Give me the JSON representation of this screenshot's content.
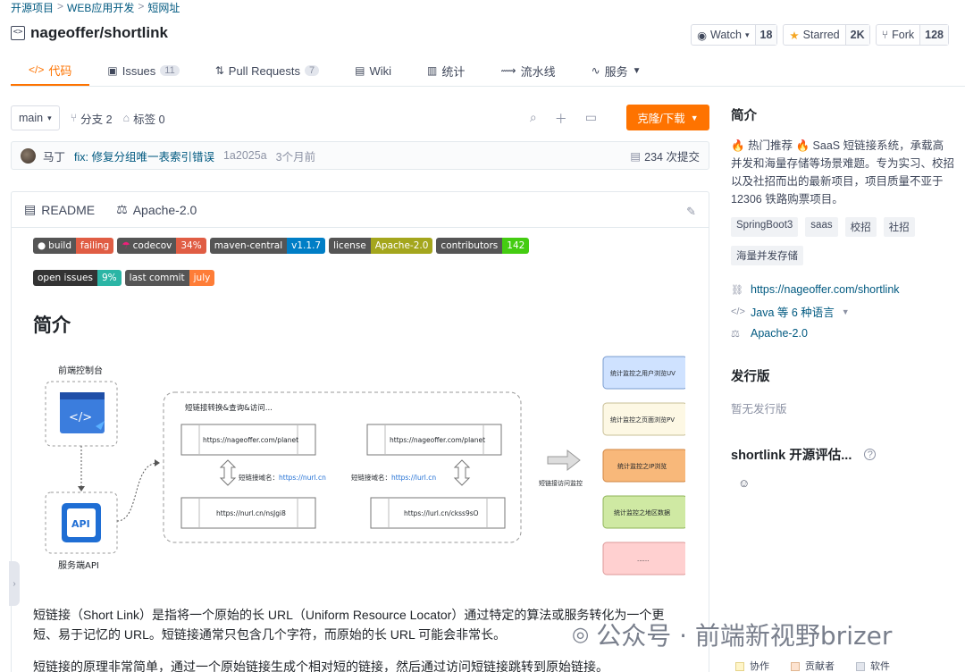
{
  "breadcrumb": [
    "开源项目",
    "WEB应用开发",
    "短网址"
  ],
  "repo": {
    "name": "nageoffer/shortlink"
  },
  "actions": {
    "watch": {
      "label": "Watch",
      "count": "18"
    },
    "star": {
      "label": "Starred",
      "count": "2K"
    },
    "fork": {
      "label": "Fork",
      "count": "128"
    }
  },
  "tabs": [
    {
      "icon": "</>",
      "label": "代码"
    },
    {
      "icon": "▣",
      "label": "Issues",
      "count": "11"
    },
    {
      "icon": "⇅",
      "label": "Pull Requests",
      "count": "7"
    },
    {
      "icon": "▤",
      "label": "Wiki"
    },
    {
      "icon": "▥",
      "label": "统计"
    },
    {
      "icon": "⟿",
      "label": "流水线"
    },
    {
      "icon": "∿",
      "label": "服务"
    }
  ],
  "toolbar": {
    "branch": "main",
    "branches": "分支 2",
    "tags": "标签 0",
    "clone": "克隆/下载"
  },
  "commit": {
    "author": "马丁",
    "message": "fix: 修复分组唯一表索引错误",
    "sha": "1a2025a",
    "time": "3个月前",
    "count": "234 次提交"
  },
  "readme": {
    "tab1": "README",
    "tab2": "Apache-2.0",
    "badges": [
      {
        "k": "build",
        "v": "failing",
        "color": "#e05d44"
      },
      {
        "k": "codecov",
        "v": "34%",
        "color": "#e05d44"
      },
      {
        "k": "maven-central",
        "v": "v1.1.7",
        "color": "#007ec6"
      },
      {
        "k": "license",
        "v": "Apache-2.0",
        "color": "#a4a61d"
      },
      {
        "k": "contributors",
        "v": "142",
        "color": "#4c1"
      },
      {
        "k": "open issues",
        "v": "9%",
        "color": "#2bb5a5"
      },
      {
        "k": "last commit",
        "v": "july",
        "color": "#fe7d37"
      }
    ],
    "h1": "简介",
    "para1": "短链接（Short Link）是指将一个原始的长 URL（Uniform Resource Locator）通过特定的算法或服务转化为一个更短、易于记忆的 URL。短链接通常只包含几个字符，而原始的长 URL 可能会非常长。",
    "para2": "短链接的原理非常简单，通过一个原始链接生成个相对短的链接，然后通过访问短链接跳转到原始链接。"
  },
  "diagram": {
    "frontend": "前端控制台",
    "backend": "服务端API",
    "api_chip": "API",
    "group_title": "短链接转换&查询&访问...",
    "url1": "https://nageoffer.com/planet",
    "url2": "https://nageoffer.com/planet",
    "domain1_label": "短链接域名：",
    "domain1": "https://nurl.cn",
    "domain2_label": "短链接域名：",
    "domain2": "https://lurl.cn",
    "short1": "https://nurl.cn/nsJgi8",
    "short2": "https://lurl.cn/ckss9sO",
    "monitor": "短链接访问监控",
    "stats": [
      "统计监控之用户浏览UV",
      "统计监控之页面浏览PV",
      "统计监控之IP浏览",
      "统计监控之地区数据",
      "......"
    ]
  },
  "sidebar": {
    "intro_title": "简介",
    "desc": "🔥 热门推荐 🔥 SaaS 短链接系统，承载高并发和海量存储等场景难题。专为实习、校招以及社招而出的最新项目，项目质量不亚于 12306 铁路购票项目。",
    "tags": [
      "SpringBoot3",
      "saas",
      "校招",
      "社招",
      "海量并发存储"
    ],
    "link": "https://nageoffer.com/shortlink",
    "language": "Java 等 6 种语言",
    "license": "Apache-2.0",
    "release_title": "发行版",
    "release_empty": "暂无发行版",
    "eval_title": "shortlink 开源评估...",
    "emoji": "☺"
  },
  "watermark": "公众号 · 前端新视野brizer",
  "legend": [
    "协作",
    "贡献者",
    "软件"
  ]
}
